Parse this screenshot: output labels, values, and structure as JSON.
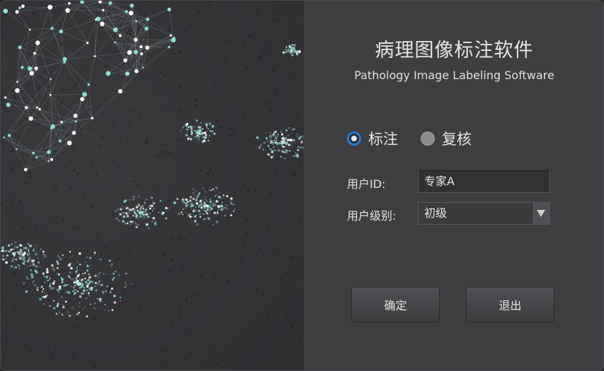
{
  "app": {
    "title_cn": "病理图像标注软件",
    "title_en": "Pathology Image Labeling Software"
  },
  "mode": {
    "options": [
      {
        "label": "标注",
        "checked": true
      },
      {
        "label": "复核",
        "checked": false
      }
    ]
  },
  "form": {
    "user_id_label": "用户ID:",
    "user_id_value": "专家A",
    "user_level_label": "用户级别:",
    "user_level_value": "初级"
  },
  "buttons": {
    "confirm_label": "确定",
    "exit_label": "退出"
  },
  "colors": {
    "accent": "#1e7fd6",
    "cell_highlight": "#8fe0d6",
    "panel_bg": "#3e3e41"
  }
}
